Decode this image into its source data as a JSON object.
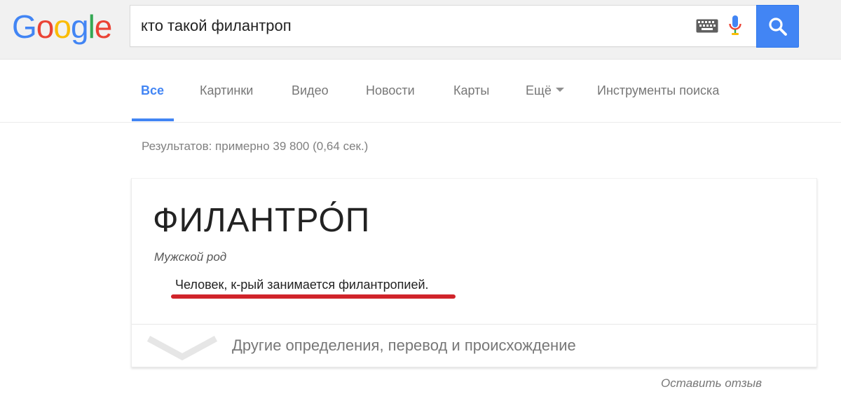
{
  "header": {
    "logo_letters": [
      {
        "ch": "G",
        "color": "#4285f4"
      },
      {
        "ch": "o",
        "color": "#ea4335"
      },
      {
        "ch": "o",
        "color": "#fbbc05"
      },
      {
        "ch": "g",
        "color": "#4285f4"
      },
      {
        "ch": "l",
        "color": "#34a853"
      },
      {
        "ch": "e",
        "color": "#ea4335"
      }
    ],
    "search_query": "кто такой филантроп",
    "icons": {
      "keyboard": "keyboard-icon",
      "mic": "microphone-icon",
      "search": "search-icon"
    },
    "search_button_color": "#4285f4"
  },
  "tabs": {
    "items": [
      {
        "label": "Все",
        "active": true
      },
      {
        "label": "Картинки",
        "active": false
      },
      {
        "label": "Видео",
        "active": false
      },
      {
        "label": "Новости",
        "active": false
      },
      {
        "label": "Карты",
        "active": false
      },
      {
        "label": "Ещё",
        "active": false,
        "has_dropdown": true
      },
      {
        "label": "Инструменты поиска",
        "active": false
      }
    ],
    "active_color": "#4285f4"
  },
  "results": {
    "stats": "Результатов: примерно 39 800 (0,64 сек.)"
  },
  "dictionary_card": {
    "word": "ФИЛАНТРО́П",
    "part_of_speech": "Мужской род",
    "definition": "Человек, к-рый занимается филантропией.",
    "highlight_color": "#d0242a",
    "expand_label": "Другие определения, перевод и происхождение"
  },
  "footer": {
    "feedback_label": "Оставить отзыв"
  }
}
